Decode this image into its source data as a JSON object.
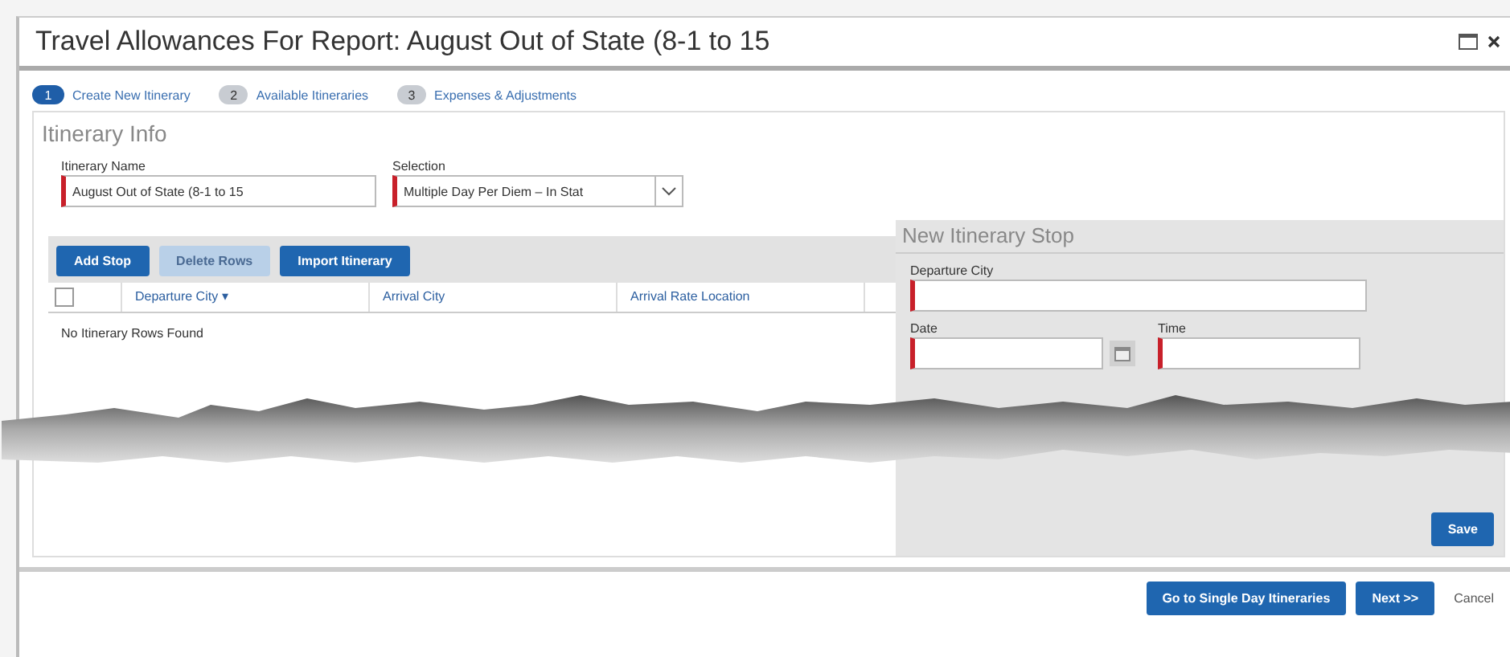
{
  "window": {
    "title": "Travel Allowances For Report: August Out of State (8-1 to 15"
  },
  "steps": [
    {
      "number": "1",
      "label": "Create New Itinerary",
      "selected": true
    },
    {
      "number": "2",
      "label": "Available Itineraries",
      "selected": false
    },
    {
      "number": "3",
      "label": "Expenses & Adjustments",
      "selected": false
    }
  ],
  "itinerary_info": {
    "title": "Itinerary Info",
    "fields": [
      {
        "label": "Itinerary Name",
        "value": "August Out of State (8-1 to 15",
        "kind": "text"
      },
      {
        "label": "Selection",
        "value": "Multiple Day Per Diem – In Stat",
        "kind": "select"
      }
    ]
  },
  "toolbar": [
    {
      "label": "Add Stop",
      "disabled": false
    },
    {
      "label": "Delete Rows",
      "disabled": true
    },
    {
      "label": "Import Itinerary",
      "disabled": false
    }
  ],
  "table": {
    "select_all": {
      "checked": false
    },
    "columns": [
      "Departure City ▾",
      "Arrival City",
      "Arrival Rate Location"
    ],
    "empty_message": "No Itinerary Rows Found"
  },
  "new_stop": {
    "title": "New Itinerary Stop",
    "fields": [
      {
        "label": "Departure City",
        "kind": "text"
      },
      {
        "label": "Date",
        "kind": "date"
      },
      {
        "label": "Time",
        "kind": "text"
      }
    ],
    "save": "Save"
  },
  "footer": [
    {
      "label": "Go to Single Day Itineraries",
      "kind": "primary"
    },
    {
      "label": "Next >>",
      "kind": "primary"
    },
    {
      "label": "Cancel",
      "kind": "link"
    }
  ]
}
